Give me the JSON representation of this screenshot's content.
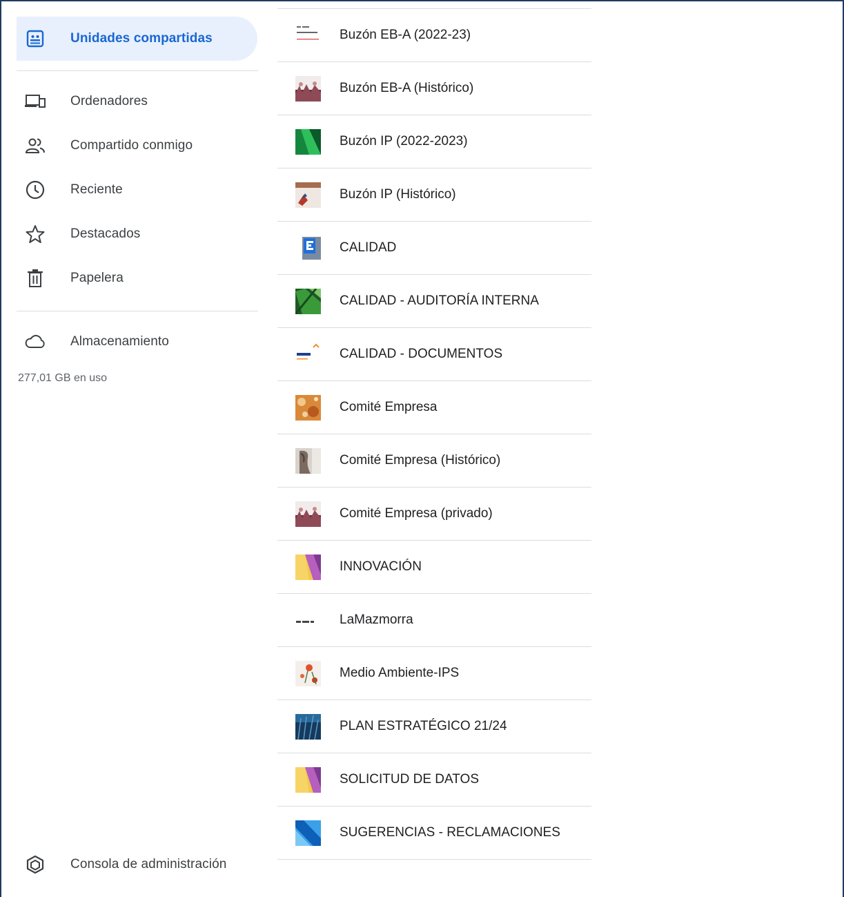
{
  "sidebar": {
    "shared_drives": {
      "label": "Unidades compartidas",
      "icon": "shared-drives-icon"
    },
    "items": [
      {
        "label": "Ordenadores",
        "icon": "computers-icon"
      },
      {
        "label": "Compartido conmigo",
        "icon": "people-icon"
      },
      {
        "label": "Reciente",
        "icon": "clock-icon"
      },
      {
        "label": "Destacados",
        "icon": "star-icon"
      },
      {
        "label": "Papelera",
        "icon": "trash-icon"
      }
    ],
    "storage": {
      "label": "Almacenamiento",
      "icon": "cloud-icon",
      "usage": "277,01 GB en uso"
    },
    "admin": {
      "label": "Consola de administración",
      "icon": "admin-console-icon"
    },
    "accent_color": "#1967d2",
    "active_bg": "#e8f0fe"
  },
  "drives": [
    {
      "name": "Buzón EB-A (2022-23)",
      "thumb": "text-logo"
    },
    {
      "name": "Buzón EB-A (Histórico)",
      "thumb": "concert-photo"
    },
    {
      "name": "Buzón IP (2022-2023)",
      "thumb": "green-abstract"
    },
    {
      "name": "Buzón IP (Histórico)",
      "thumb": "desk-photo"
    },
    {
      "name": "CALIDAD",
      "thumb": "letter-e-sign"
    },
    {
      "name": "CALIDAD - AUDITORÍA INTERNA",
      "thumb": "leaf-photo"
    },
    {
      "name": "CALIDAD - DOCUMENTOS",
      "thumb": "brand-logo"
    },
    {
      "name": "Comité Empresa",
      "thumb": "orange-texture"
    },
    {
      "name": "Comité Empresa (Histórico)",
      "thumb": "sculpture-photo"
    },
    {
      "name": "Comité Empresa (privado)",
      "thumb": "concert-photo"
    },
    {
      "name": "INNOVACIÓN",
      "thumb": "yellow-purple-abstract"
    },
    {
      "name": "LaMazmorra",
      "thumb": "small-logo"
    },
    {
      "name": "Medio Ambiente-IPS",
      "thumb": "flowers-photo"
    },
    {
      "name": "PLAN ESTRATÉGICO 21/24",
      "thumb": "blue-texture"
    },
    {
      "name": "SOLICITUD DE DATOS",
      "thumb": "yellow-purple-abstract"
    },
    {
      "name": "SUGERENCIAS - RECLAMACIONES",
      "thumb": "blue-stripes"
    }
  ]
}
